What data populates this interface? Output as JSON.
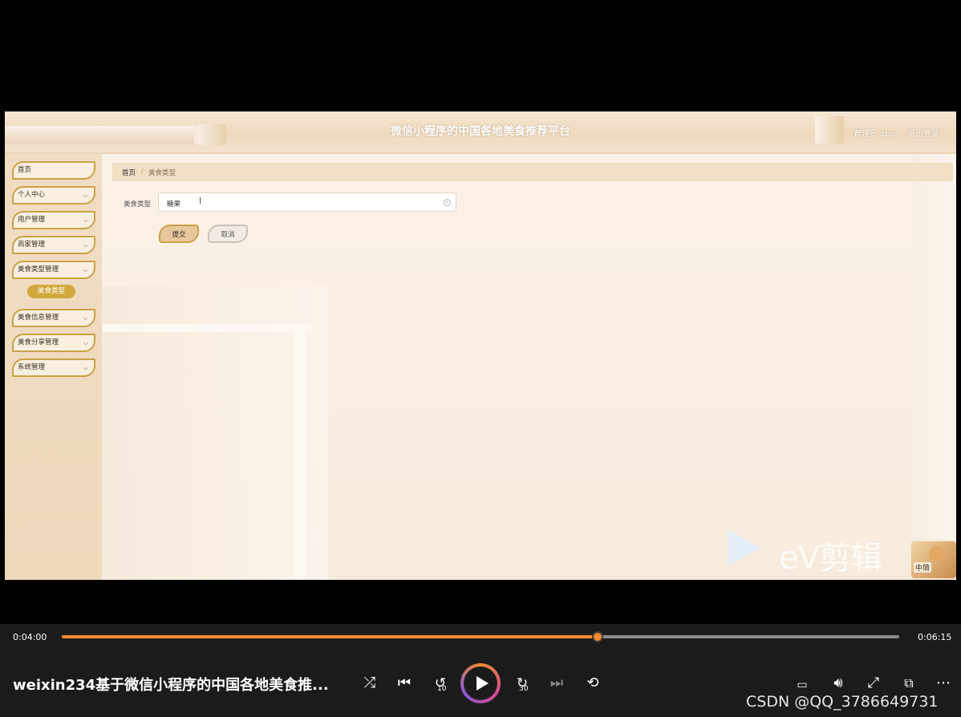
{
  "app": {
    "title": "微信小程序的中国各地美食推荐平台",
    "user_label": "管理员 abo",
    "logout_label": "退出登录"
  },
  "sidebar": {
    "items": [
      {
        "label": "首页",
        "chevron": false
      },
      {
        "label": "个人中心",
        "chevron": true
      },
      {
        "label": "用户管理",
        "chevron": true
      },
      {
        "label": "商家管理",
        "chevron": true
      },
      {
        "label": "美食类型管理",
        "chevron": true
      },
      {
        "label": "美食信息管理",
        "chevron": true
      },
      {
        "label": "美食分享管理",
        "chevron": true
      },
      {
        "label": "系统管理",
        "chevron": true
      }
    ],
    "active_sub_item": "美食类型"
  },
  "breadcrumb": {
    "home": "首页",
    "separator": "/",
    "current": "美食类型"
  },
  "form": {
    "field_label": "美食类型",
    "field_value": "糖果",
    "submit_label": "提交",
    "cancel_label": "取消"
  },
  "watermark": {
    "brand_text": "eV剪辑",
    "badge_text": "中简"
  },
  "player": {
    "current_time": "0:04:00",
    "total_time": "0:06:15",
    "progress": 0.64,
    "title": "weixin234基于微信小程序的中国各地美食推...",
    "csdn_watermark": "CSDN @QQ_3786649731"
  },
  "colors": {
    "accent_gold": "#c9a243",
    "progress_orange": "#f28a30",
    "sidebar_bg": "#f1ddc4",
    "player_bg": "#1b1b1b"
  },
  "icons": {
    "nav_chevron": "chevron-down-icon",
    "input_clear": "clear-icon",
    "shuffle": "shuffle-icon",
    "previous": "previous-icon",
    "back10": "rewind-10-icon",
    "play": "play-icon",
    "fwd30": "forward-30-icon",
    "next": "next-icon",
    "repeat": "repeat-icon",
    "subtitles": "subtitles-icon",
    "volume": "volume-icon",
    "fullscreen": "fullscreen-icon",
    "miniplayer": "miniplayer-icon",
    "more": "more-icon"
  }
}
